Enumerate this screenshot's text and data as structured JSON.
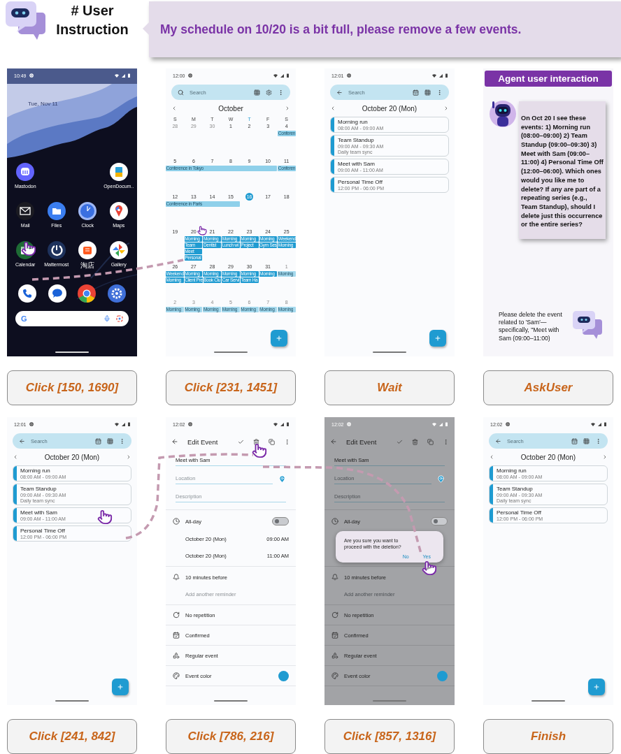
{
  "header": {
    "title": "# User Instruction",
    "instruction": "My schedule on 10/20 is a bit full, please remove a few events."
  },
  "steps": [
    {
      "action": "Click [150, 1690]",
      "screen": {
        "kind": "home",
        "time": "10:49",
        "date": "Tue, Nov 11",
        "search_logo": "G",
        "apps": [
          [
            {
              "kind": "app",
              "label": "Mastodon"
            },
            {
              "kind": "gap"
            },
            {
              "kind": "gap"
            },
            {
              "kind": "app",
              "label": "OpenDocum.."
            }
          ],
          [
            {
              "kind": "app",
              "label": "Mail"
            },
            {
              "kind": "app",
              "label": "Files"
            },
            {
              "kind": "app",
              "label": "Clock"
            },
            {
              "kind": "app",
              "label": "Maps"
            }
          ],
          [
            {
              "kind": "app",
              "label": "Calendar",
              "tapped": true
            },
            {
              "kind": "app",
              "label": "Mattermost"
            },
            {
              "kind": "app",
              "label": "淘店"
            },
            {
              "kind": "app",
              "label": "Gallery"
            }
          ]
        ]
      }
    },
    {
      "action": "Click [231, 1451]",
      "screen": {
        "kind": "month",
        "time": "12:00",
        "search": {
          "placeholder": "Search"
        },
        "month": "October",
        "weekdays": [
          {
            "label": "S",
            "today": false
          },
          {
            "label": "M",
            "today": false
          },
          {
            "label": "T",
            "today": false
          },
          {
            "label": "W",
            "today": false
          },
          {
            "label": "T",
            "today": true
          },
          {
            "label": "F",
            "today": false
          },
          {
            "label": "S",
            "today": false
          }
        ],
        "weeks": [
          {
            "days": [
              {
                "label": "28",
                "muted": true,
                "today": false
              },
              {
                "label": "29",
                "muted": true,
                "today": false
              },
              {
                "label": "30",
                "muted": true,
                "today": false
              },
              {
                "label": "1",
                "muted": false,
                "today": false
              },
              {
                "label": "2",
                "muted": false,
                "today": false
              },
              {
                "label": "3",
                "muted": false,
                "today": false
              },
              {
                "label": "4",
                "muted": false,
                "today": false
              }
            ],
            "lanes": [
              [
                {
                  "kind": "none"
                },
                {
                  "kind": "none"
                },
                {
                  "kind": "none"
                },
                {
                  "kind": "none"
                },
                {
                  "kind": "none"
                },
                {
                  "kind": "none"
                },
                {
                  "kind": "start",
                  "text": "Conferen",
                  "color": "#8fd0ea"
                }
              ]
            ]
          },
          {
            "days": [
              {
                "label": "5",
                "muted": false,
                "today": false
              },
              {
                "label": "6",
                "muted": false,
                "today": false
              },
              {
                "label": "7",
                "muted": false,
                "today": false
              },
              {
                "label": "8",
                "muted": false,
                "today": false
              },
              {
                "label": "9",
                "muted": false,
                "today": false
              },
              {
                "label": "10",
                "muted": false,
                "today": false
              },
              {
                "label": "11",
                "muted": false,
                "today": false
              }
            ],
            "lanes": [
              [
                {
                  "kind": "start",
                  "text": "Conference in Tokyo",
                  "color": "#8fd0ea"
                },
                {
                  "kind": "cont"
                },
                {
                  "kind": "cont"
                },
                {
                  "kind": "cont"
                },
                {
                  "kind": "cont"
                },
                {
                  "kind": "cont"
                },
                {
                  "kind": "start",
                  "text": "Conferen",
                  "color": "#8fd0ea"
                }
              ]
            ]
          },
          {
            "days": [
              {
                "label": "12",
                "muted": false,
                "today": false
              },
              {
                "label": "13",
                "muted": false,
                "today": false
              },
              {
                "label": "14",
                "muted": false,
                "today": false
              },
              {
                "label": "15",
                "muted": false,
                "today": false
              },
              {
                "label": "16",
                "muted": false,
                "today": true
              },
              {
                "label": "17",
                "muted": false,
                "today": false
              },
              {
                "label": "18",
                "muted": false,
                "today": false
              }
            ],
            "lanes": [
              [
                {
                  "kind": "start",
                  "text": "Conference in Paris",
                  "color": "#8fd0ea"
                },
                {
                  "kind": "cont"
                },
                {
                  "kind": "cont"
                },
                {
                  "kind": "cont"
                },
                {
                  "kind": "none"
                },
                {
                  "kind": "none"
                },
                {
                  "kind": "none"
                }
              ]
            ]
          },
          {
            "days": [
              {
                "label": "19",
                "muted": false,
                "today": false
              },
              {
                "label": "20",
                "muted": false,
                "today": false,
                "tapped": true
              },
              {
                "label": "21",
                "muted": false,
                "today": false
              },
              {
                "label": "22",
                "muted": false,
                "today": false
              },
              {
                "label": "23",
                "muted": false,
                "today": false
              },
              {
                "label": "24",
                "muted": false,
                "today": false
              },
              {
                "label": "25",
                "muted": false,
                "today": false
              }
            ],
            "lanes": [
              [
                {
                  "kind": "none"
                },
                {
                  "kind": "start",
                  "text": "Morning",
                  "color": "#1f9bd1"
                },
                {
                  "kind": "start",
                  "text": "Morning",
                  "color": "#1f9bd1"
                },
                {
                  "kind": "start",
                  "text": "Morning",
                  "color": "#1f9bd1"
                },
                {
                  "kind": "start",
                  "text": "Morning",
                  "color": "#1f9bd1"
                },
                {
                  "kind": "start",
                  "text": "Morning",
                  "color": "#1f9bd1"
                },
                {
                  "kind": "start",
                  "text": "Weekend",
                  "color": "#1f9bd1"
                }
              ],
              [
                {
                  "kind": "none"
                },
                {
                  "kind": "start",
                  "text": "Team",
                  "color": "#1f9bd1"
                },
                {
                  "kind": "start",
                  "text": "Dentist",
                  "color": "#1f9bd1"
                },
                {
                  "kind": "start",
                  "text": "Lunch wi",
                  "color": "#1f9bd1"
                },
                {
                  "kind": "start",
                  "text": "Project",
                  "color": "#1f9bd1"
                },
                {
                  "kind": "start",
                  "text": "Gym Ses",
                  "color": "#1f9bd1"
                },
                {
                  "kind": "start",
                  "text": "Morning",
                  "color": "#1f9bd1"
                }
              ],
              [
                {
                  "kind": "none"
                },
                {
                  "kind": "start",
                  "text": "Meet",
                  "color": "#1f9bd1"
                },
                {
                  "kind": "none"
                },
                {
                  "kind": "none"
                },
                {
                  "kind": "none"
                },
                {
                  "kind": "none"
                },
                {
                  "kind": "none"
                }
              ],
              [
                {
                  "kind": "none"
                },
                {
                  "kind": "start",
                  "text": "Personal",
                  "color": "#1f9bd1"
                },
                {
                  "kind": "none"
                },
                {
                  "kind": "none"
                },
                {
                  "kind": "none"
                },
                {
                  "kind": "none"
                },
                {
                  "kind": "none"
                }
              ]
            ]
          },
          {
            "days": [
              {
                "label": "26",
                "muted": false,
                "today": false
              },
              {
                "label": "27",
                "muted": false,
                "today": false
              },
              {
                "label": "28",
                "muted": false,
                "today": false
              },
              {
                "label": "29",
                "muted": false,
                "today": false
              },
              {
                "label": "30",
                "muted": false,
                "today": false
              },
              {
                "label": "31",
                "muted": false,
                "today": false
              },
              {
                "label": "1",
                "muted": true,
                "today": false
              }
            ],
            "lanes": [
              [
                {
                  "kind": "start",
                  "text": "Weekend",
                  "color": "#1f9bd1"
                },
                {
                  "kind": "start",
                  "text": "Morning",
                  "color": "#1f9bd1"
                },
                {
                  "kind": "start",
                  "text": "Morning",
                  "color": "#1f9bd1"
                },
                {
                  "kind": "start",
                  "text": "Morning",
                  "color": "#1f9bd1"
                },
                {
                  "kind": "start",
                  "text": "Morning",
                  "color": "#1f9bd1"
                },
                {
                  "kind": "start",
                  "text": "Morning",
                  "color": "#1f9bd1"
                },
                {
                  "kind": "start",
                  "text": "Morning",
                  "color": "#a6daee"
                }
              ],
              [
                {
                  "kind": "start",
                  "text": "Morning",
                  "color": "#1f9bd1"
                },
                {
                  "kind": "start",
                  "text": "Client Pre",
                  "color": "#1f9bd1"
                },
                {
                  "kind": "start",
                  "text": "Book Clu",
                  "color": "#1f9bd1"
                },
                {
                  "kind": "start",
                  "text": "Car Servi",
                  "color": "#1f9bd1"
                },
                {
                  "kind": "start",
                  "text": "Team Ha",
                  "color": "#1f9bd1"
                },
                {
                  "kind": "none"
                },
                {
                  "kind": "none"
                }
              ]
            ]
          },
          {
            "days": [
              {
                "label": "2",
                "muted": true,
                "today": false
              },
              {
                "label": "3",
                "muted": true,
                "today": false
              },
              {
                "label": "4",
                "muted": true,
                "today": false
              },
              {
                "label": "5",
                "muted": true,
                "today": false
              },
              {
                "label": "6",
                "muted": true,
                "today": false
              },
              {
                "label": "7",
                "muted": true,
                "today": false
              },
              {
                "label": "8",
                "muted": true,
                "today": false
              }
            ],
            "lanes": [
              [
                {
                  "kind": "start",
                  "text": "Morning",
                  "color": "#a6daee"
                },
                {
                  "kind": "start",
                  "text": "Morning",
                  "color": "#a6daee"
                },
                {
                  "kind": "start",
                  "text": "Morning",
                  "color": "#a6daee"
                },
                {
                  "kind": "start",
                  "text": "Morning",
                  "color": "#a6daee"
                },
                {
                  "kind": "start",
                  "text": "Morning",
                  "color": "#a6daee"
                },
                {
                  "kind": "start",
                  "text": "Morning",
                  "color": "#a6daee"
                },
                {
                  "kind": "start",
                  "text": "Morning",
                  "color": "#a6daee"
                }
              ]
            ]
          }
        ]
      }
    },
    {
      "action": "Wait",
      "screen": {
        "kind": "day",
        "time": "12:01",
        "search": {
          "placeholder": "Search"
        },
        "date_title": "October 20 (Mon)",
        "events": [
          {
            "title": "Morning run",
            "time": "08:00 AM - 09:00 AM"
          },
          {
            "title": "Team Standup",
            "time": "09:00 AM - 09:30 AM",
            "note": "Daily team sync"
          },
          {
            "title": "Meet with Sam",
            "time": "09:00 AM - 11:00 AM"
          },
          {
            "title": "Personal Time Off",
            "time": "12:00 PM - 06:00 PM"
          }
        ]
      }
    },
    {
      "action": "AskUser",
      "screen": {
        "kind": "chat",
        "title": "Agent user interaction",
        "agent_message": "On Oct 20 I see these events: 1) Morning run (08:00–09:00) 2) Team Standup (09:00–09:30) 3) Meet with Sam (09:00–11:00) 4) Personal Time Off (12:00–06:00). Which ones would you like me to delete? If any are part of a repeating series (e.g., Team Standup), should I delete just this occurrence or the entire series?",
        "user_message": "Please delete the event related to 'Sam'—specifically, \"Meet with Sam (09:00–11:00)"
      }
    },
    {
      "action": "Click [241, 842]",
      "screen": {
        "kind": "day",
        "time": "12:01",
        "search": {
          "placeholder": "Search"
        },
        "date_title": "October 20 (Mon)",
        "events": [
          {
            "title": "Morning run",
            "time": "08:00 AM - 09:00 AM"
          },
          {
            "title": "Team Standup",
            "time": "09:00 AM - 09:30 AM",
            "note": "Daily team sync"
          },
          {
            "title": "Meet with Sam",
            "time": "09:00 AM - 11:00 AM",
            "tapped": true
          },
          {
            "title": "Personal Time Off",
            "time": "12:00 PM - 06:00 PM"
          }
        ]
      }
    },
    {
      "action": "Click [786, 216]",
      "screen": {
        "kind": "edit",
        "time": "12:02",
        "dimmed": false,
        "title": "Edit Event",
        "actions": [
          {
            "kind": "confirm"
          },
          {
            "kind": "delete",
            "tapped": true
          },
          {
            "kind": "duplicate"
          },
          {
            "kind": "more"
          }
        ],
        "name": {
          "value": "Meet with Sam"
        },
        "location": {
          "placeholder": "Location"
        },
        "description": {
          "placeholder": "Description"
        },
        "all_day": {
          "label": "All-day",
          "on": false
        },
        "dates": [
          {
            "date": "October 20 (Mon)",
            "time": "09:00 AM"
          },
          {
            "date": "October 20 (Mon)",
            "time": "11:00 AM"
          }
        ],
        "reminder": "10 minutes before",
        "add_reminder": "Add another reminder",
        "options": [
          {
            "kind": "repeat",
            "label": "No repetition"
          },
          {
            "kind": "status",
            "label": "Confirmed"
          },
          {
            "kind": "type",
            "label": "Regular event"
          },
          {
            "kind": "color",
            "label": "Event color",
            "color": "#1f9bd1"
          }
        ]
      }
    },
    {
      "action": "Click [857, 1316]",
      "screen": {
        "kind": "edit",
        "time": "12:02",
        "dimmed": true,
        "title": "Edit Event",
        "actions": [
          {
            "kind": "confirm"
          },
          {
            "kind": "delete"
          },
          {
            "kind": "duplicate"
          },
          {
            "kind": "more"
          }
        ],
        "name": {
          "value": "Meet with Sam"
        },
        "location": {
          "placeholder": "Location"
        },
        "description": {
          "placeholder": "Description"
        },
        "all_day": {
          "label": "All-day",
          "on": false
        },
        "reminder": "10 minutes before",
        "add_reminder": "Add another reminder",
        "options": [
          {
            "kind": "repeat",
            "label": "No repetition"
          },
          {
            "kind": "status",
            "label": "Confirmed"
          },
          {
            "kind": "type",
            "label": "Regular event"
          },
          {
            "kind": "color",
            "label": "Event color",
            "color": "#1f9bd1"
          }
        ],
        "dialog": {
          "message": "Are you sure you want to proceed with the deletion?",
          "buttons": [
            {
              "label": "No"
            },
            {
              "label": "Yes",
              "tapped": true
            }
          ]
        }
      }
    },
    {
      "action": "Finish",
      "screen": {
        "kind": "day",
        "time": "12:02",
        "search": {
          "placeholder": "Search"
        },
        "date_title": "October 20 (Mon)",
        "events": [
          {
            "title": "Morning run",
            "time": "08:00 AM - 09:00 AM"
          },
          {
            "title": "Team Standup",
            "time": "09:00 AM - 09:30 AM",
            "note": "Daily team sync"
          },
          {
            "title": "Personal Time Off",
            "time": "12:00 PM - 06:00 PM"
          }
        ]
      }
    }
  ]
}
